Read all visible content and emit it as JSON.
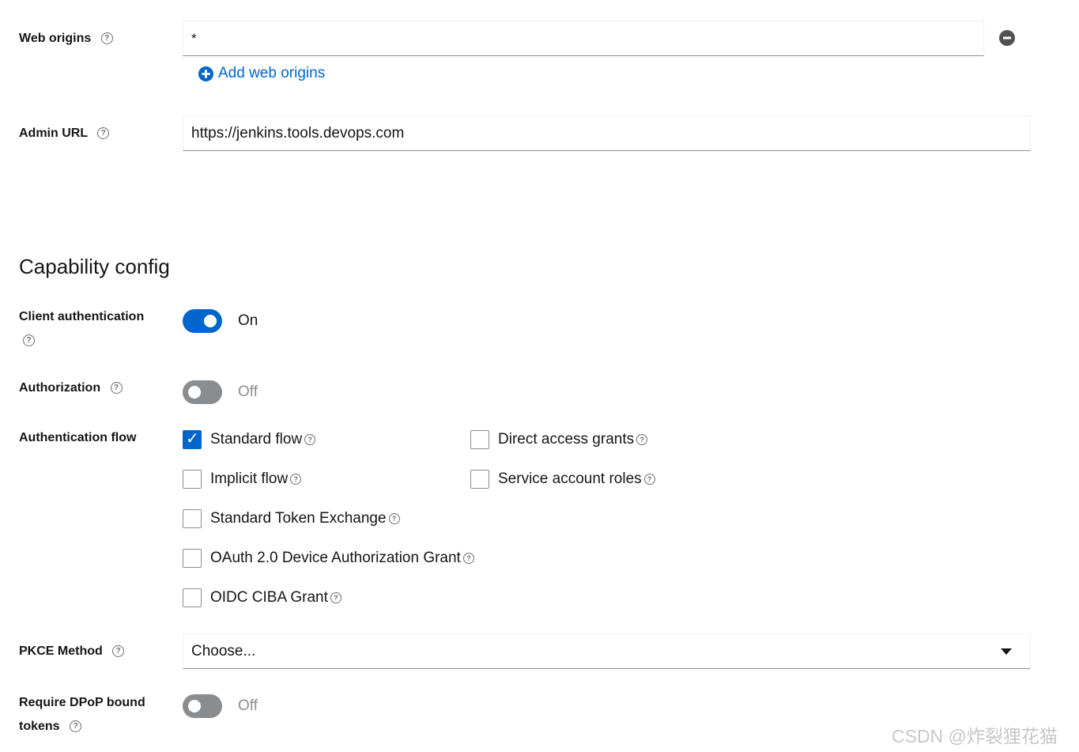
{
  "web_origins": {
    "label": "Web origins",
    "value": "*",
    "add_label": "Add web origins",
    "remove_icon": "minus-circle-icon",
    "add_icon": "plus-circle-icon"
  },
  "admin_url": {
    "label": "Admin URL",
    "value": "https://jenkins.tools.devops.com"
  },
  "capability": {
    "heading": "Capability config",
    "client_auth": {
      "label": "Client authentication",
      "state": "On",
      "enabled": true
    },
    "authorization": {
      "label": "Authorization",
      "state": "Off",
      "enabled": false
    },
    "auth_flow": {
      "label": "Authentication flow",
      "options": [
        {
          "label": "Standard flow",
          "checked": true
        },
        {
          "label": "Direct access grants",
          "checked": false
        },
        {
          "label": "Implicit flow",
          "checked": false
        },
        {
          "label": "Service account roles",
          "checked": false
        },
        {
          "label": "Standard Token Exchange",
          "checked": false
        },
        {
          "label": "OAuth 2.0 Device Authorization Grant",
          "checked": false
        },
        {
          "label": "OIDC CIBA Grant",
          "checked": false
        }
      ]
    },
    "pkce": {
      "label": "PKCE Method",
      "value": "Choose..."
    },
    "dpop": {
      "label_line1": "Require DPoP bound",
      "label_line2": "tokens",
      "state": "Off",
      "enabled": false
    }
  },
  "help_glyph": "?",
  "checkmark_glyph": "✓",
  "watermark": "CSDN @炸裂狸花猫",
  "colors": {
    "accent": "#0066cc",
    "toggle_off": "#8a8d90",
    "text": "#151515"
  }
}
